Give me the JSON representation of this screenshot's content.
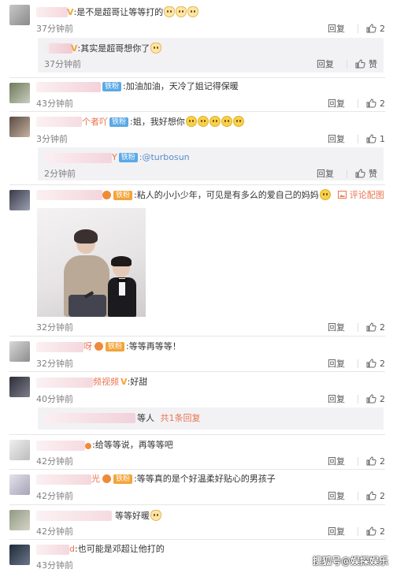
{
  "actions": {
    "reply": "回复",
    "like_icon": "thumb-up-icon"
  },
  "comments": [
    {
      "id": "c1",
      "name_suffix": "V",
      "text": ":是不是超哥让等等打的",
      "emoji_count": 3,
      "time": "37分钟前",
      "likes": "2"
    },
    {
      "id": "r1",
      "name_suffix": "V",
      "text": ":其实是超哥想你了",
      "emoji_count": 1,
      "time": "37分钟前",
      "likes": "赞"
    },
    {
      "id": "c2",
      "badge": "铁粉",
      "text": ":加油加油，天冷了姐记得保暖",
      "time": "43分钟前",
      "likes": "2"
    },
    {
      "id": "c3",
      "name_suffix": "个者吖",
      "badge": "铁粉",
      "text": ":姐，我好想你",
      "emoji_count": 5,
      "time": "3分钟前",
      "likes": "1"
    },
    {
      "id": "r2",
      "name_suffix": "Y",
      "badge": "铁粉",
      "text": ":@turbosun",
      "time": "2分钟前",
      "likes": "赞"
    },
    {
      "id": "c4",
      "badge": "铁粉",
      "text": ":粘人的小小少年，可见是有多么的爱自己的妈妈",
      "emoji_count": 1,
      "extra": "评论配图",
      "time": "32分钟前",
      "likes": "2"
    },
    {
      "id": "c5",
      "name_suffix": "呀",
      "badge": "铁粉",
      "text": ":等等再等等！",
      "time": "32分钟前",
      "likes": "2"
    },
    {
      "id": "c6",
      "name_suffix": "频视频",
      "name_badge": "V",
      "text": ":好甜",
      "time": "40分钟前",
      "likes": "2"
    },
    {
      "id": "r3",
      "text": "等人",
      "reply_total": "共1条回复"
    },
    {
      "id": "c7",
      "text": ":给等等说，再等等吧",
      "time": "42分钟前",
      "likes": "2"
    },
    {
      "id": "c8",
      "name_suffix": "光",
      "badge": "铁粉",
      "text": ":等等真的是个好温柔好贴心的男孩子",
      "time": "42分钟前",
      "likes": "2"
    },
    {
      "id": "c9",
      "text": "等等好暖",
      "emoji_count": 1,
      "time": "42分钟前",
      "likes": "2"
    },
    {
      "id": "c10",
      "name_suffix": "d",
      "text": ":也可能是邓超让他打的",
      "time": "43分钟前"
    }
  ],
  "watermark": "搜狐号@娱探娱乐",
  "colors": {
    "link_orange": "#eb7350",
    "link_blue": "#5a8cc6",
    "fan_badge": "#5aa9e6",
    "reply_bg": "#f2f2f5",
    "time_gray": "#808080"
  }
}
